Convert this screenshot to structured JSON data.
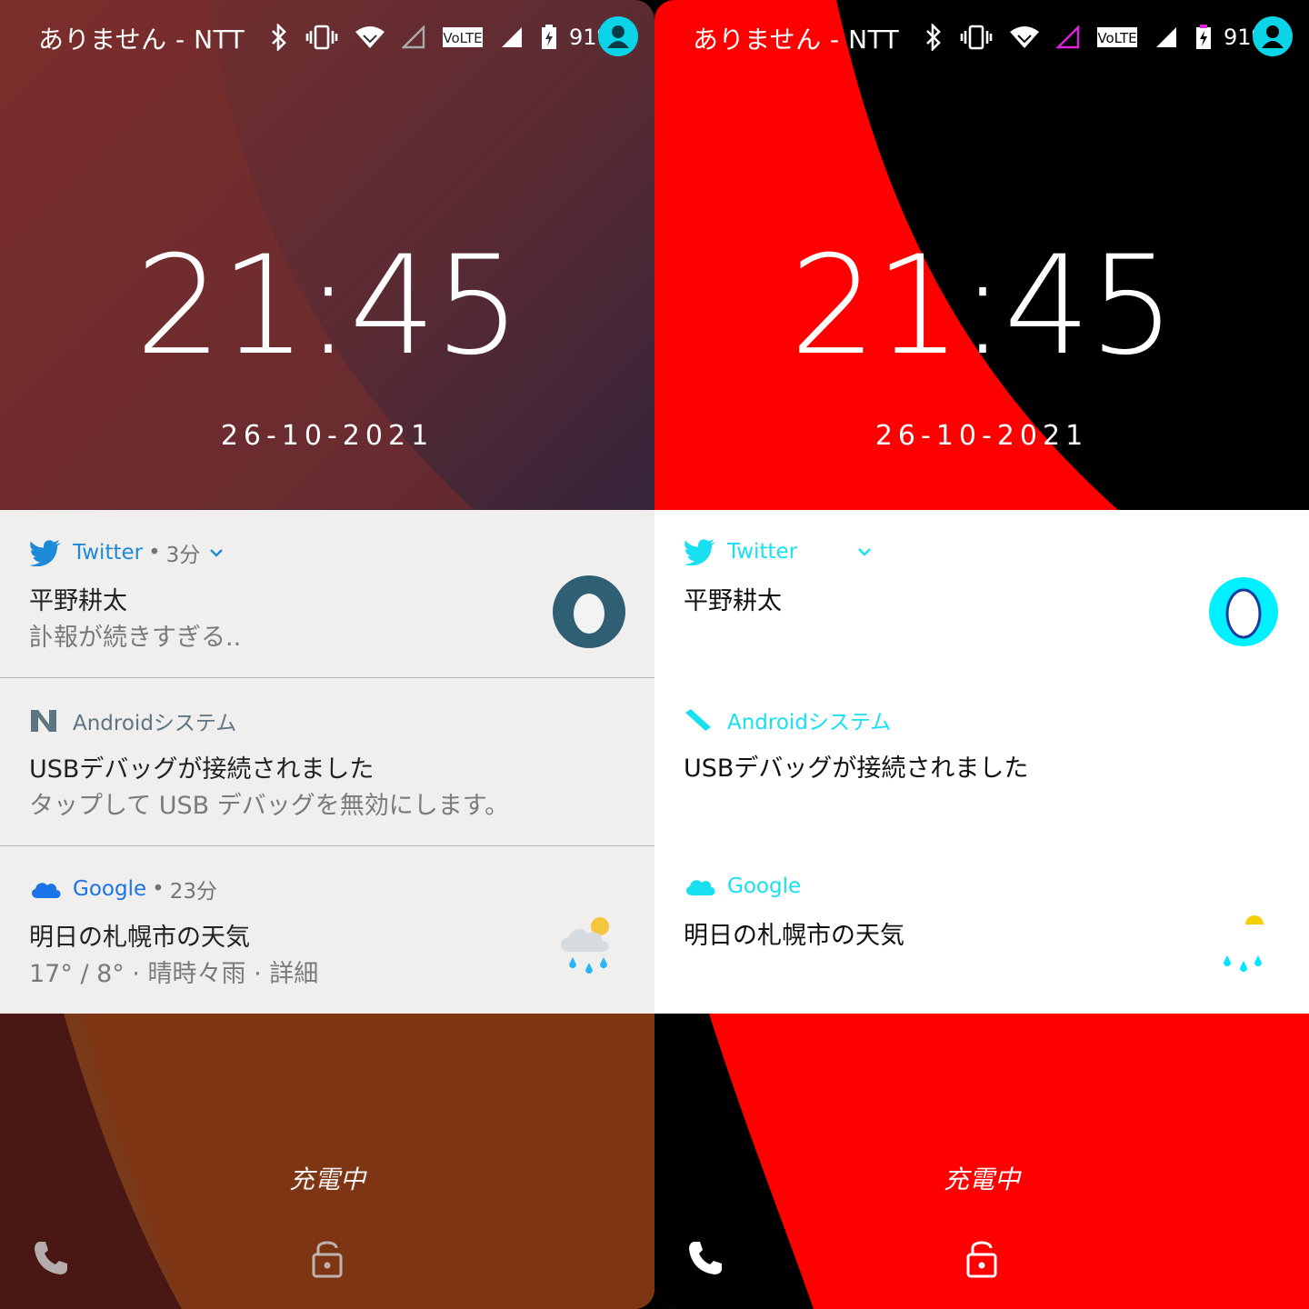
{
  "status": {
    "carrier_left": "ありません - NTT",
    "carrier_right": "ありません - NTT",
    "volte": "VoLTE",
    "battery": "91%"
  },
  "clock": {
    "time": "21:45",
    "date": "26-10-2021"
  },
  "notifications": [
    {
      "app": "Twitter",
      "separator": "•",
      "age": "3分",
      "title": "平野耕太",
      "text": "訃報が続きすぎる..",
      "icon": "twitter-bird-icon",
      "thumb": "egg-avatar"
    },
    {
      "app": "Androidシステム",
      "title": "USBデバッグが接続されました",
      "text": "タップして USB デバッグを無効にします。",
      "icon": "android-n-icon"
    },
    {
      "app": "Google",
      "separator": "•",
      "age": "23分",
      "title": "明日の札幌市の天気",
      "text": "17° / 8° · 晴時々雨 · 詳細",
      "icon": "cloud-icon",
      "thumb": "weather-rain-sun-icon"
    }
  ],
  "lockscreen": {
    "charging": "充電中"
  },
  "colors": {
    "twitter": "#1d8ad8",
    "twitter_contrast": "#18e0f0",
    "accent_avatar": "#0cd4e8",
    "right_red": "#ff0000",
    "panel_bg": "#f1efee"
  }
}
